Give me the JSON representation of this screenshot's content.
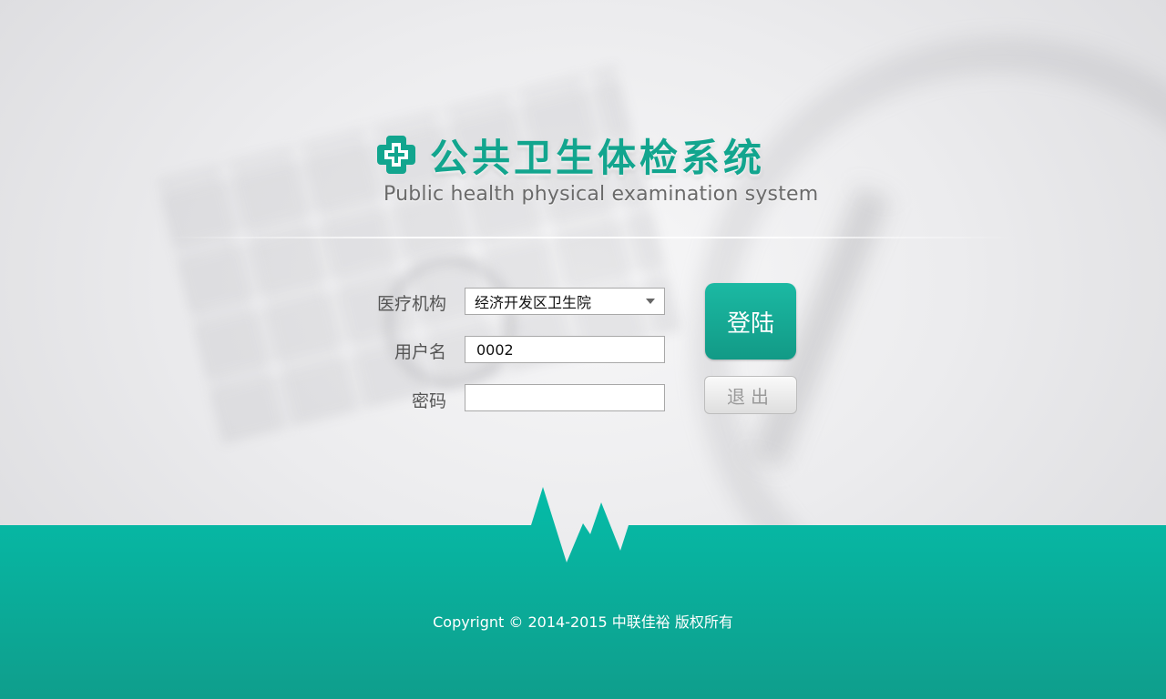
{
  "header": {
    "title_cn": "公共卫生体检系统",
    "title_en": "Public health physical examination system",
    "logo_icon": "medical-cross-icon"
  },
  "form": {
    "institution_label": "医疗机构",
    "institution_value": "经济开发区卫生院",
    "username_label": "用户名",
    "username_value": "0002",
    "password_label": "密码",
    "password_value": ""
  },
  "buttons": {
    "login_label": "登陆",
    "exit_label": "退出"
  },
  "footer": {
    "copyright": "Copyrignt © 2014-2015 中联佳裕 版权所有"
  },
  "colors": {
    "accent": "#12a58e",
    "footer_top": "#05bca8",
    "footer_bottom": "#0f9e8c"
  }
}
